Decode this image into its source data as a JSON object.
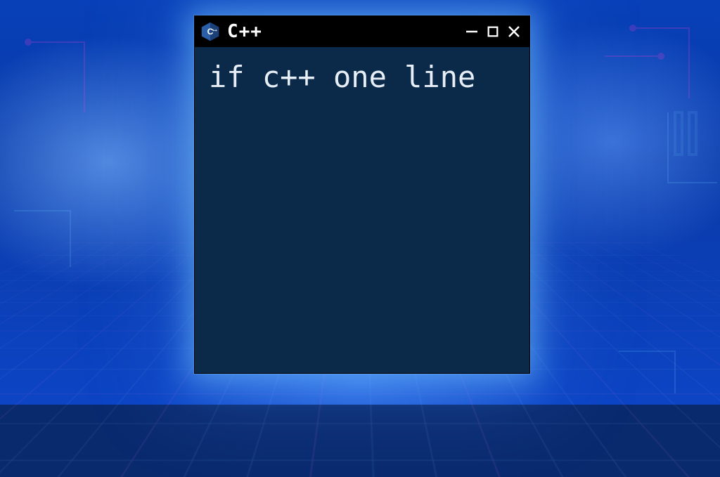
{
  "window": {
    "app_icon_name": "cpp-logo-icon",
    "title": "C++",
    "content_text": "if c++ one line"
  },
  "controls": {
    "minimize": "minimize",
    "maximize": "maximize",
    "close": "close"
  },
  "colors": {
    "window_bg": "#0b2a4a",
    "titlebar_bg": "#000000",
    "text": "#e8eef5",
    "glow": "#78c8ff"
  }
}
